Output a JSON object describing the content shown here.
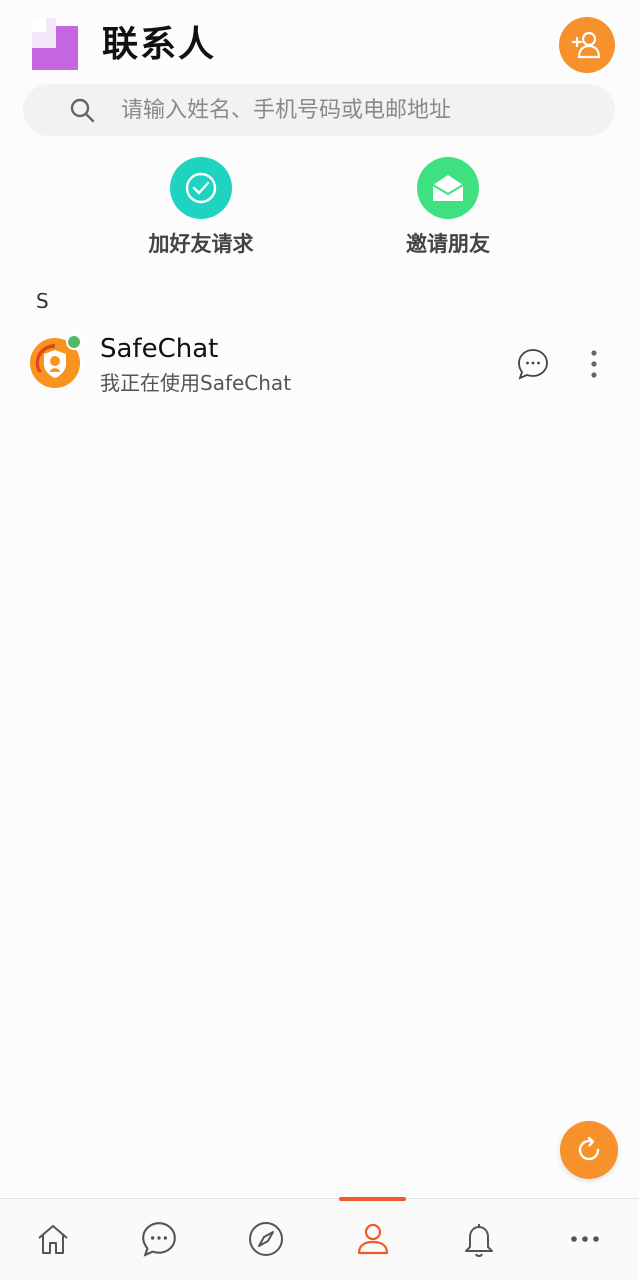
{
  "header": {
    "title": "联系人",
    "logo_icon": "app-logo-icon",
    "add_contact_icon": "add-contact-icon"
  },
  "search": {
    "placeholder": "请输入姓名、手机号码或电邮地址",
    "value": "",
    "icon": "search-icon"
  },
  "quick_actions": [
    {
      "label": "加好友请求",
      "icon": "check-circle-icon",
      "color": "#1ed4c0"
    },
    {
      "label": "邀请朋友",
      "icon": "open-envelope-icon",
      "color": "#3ee07f"
    }
  ],
  "contacts": {
    "sections": [
      {
        "letter": "S",
        "items": [
          {
            "name": "SafeChat",
            "status": "我正在使用SafeChat",
            "online": true,
            "avatar_icon": "safechat-logo-icon"
          }
        ]
      }
    ]
  },
  "fab": {
    "icon": "refresh-icon"
  },
  "bottom_nav": {
    "active_index": 3,
    "items": [
      {
        "name": "home",
        "icon": "home-icon"
      },
      {
        "name": "chats",
        "icon": "chat-bubble-icon"
      },
      {
        "name": "discover",
        "icon": "compass-icon"
      },
      {
        "name": "contacts",
        "icon": "person-icon"
      },
      {
        "name": "notifications",
        "icon": "bell-icon"
      },
      {
        "name": "more",
        "icon": "more-horizontal-icon"
      }
    ]
  },
  "colors": {
    "accent": "#f7912b",
    "active_tab": "#f05a28",
    "online": "#54b966",
    "background": "#fcfcfc",
    "search_bg": "#f2f2f2"
  }
}
